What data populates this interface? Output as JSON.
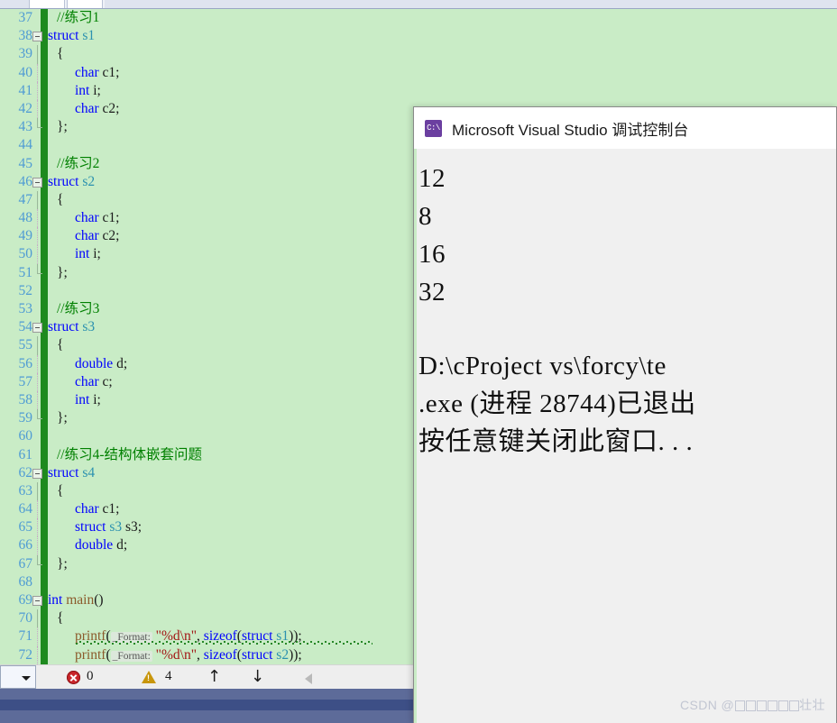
{
  "window": {
    "editor_background": "#c9ecc6",
    "change_bar_color": "#1e8a1e",
    "line_number_color": "#4f9bd4"
  },
  "editor": {
    "first_line_number": 37,
    "lines": [
      {
        "n": 37,
        "indent": 1,
        "fold": false,
        "guide": "none",
        "tokens": [
          {
            "t": "//练习1",
            "c": "cmt"
          }
        ]
      },
      {
        "n": 38,
        "indent": 0,
        "fold": true,
        "guide": "none",
        "tokens": [
          {
            "t": "struct",
            "c": "kw"
          },
          {
            "t": " ",
            "c": "plain"
          },
          {
            "t": "s1",
            "c": "typ"
          }
        ]
      },
      {
        "n": 39,
        "indent": 1,
        "fold": false,
        "guide": "solid",
        "tokens": [
          {
            "t": "{",
            "c": "plain"
          }
        ]
      },
      {
        "n": 40,
        "indent": 3,
        "fold": false,
        "guide": "dotted",
        "tokens": [
          {
            "t": "char",
            "c": "kw"
          },
          {
            "t": " c1;",
            "c": "plain"
          }
        ]
      },
      {
        "n": 41,
        "indent": 3,
        "fold": false,
        "guide": "dotted",
        "tokens": [
          {
            "t": "int",
            "c": "kw"
          },
          {
            "t": " i;",
            "c": "plain"
          }
        ]
      },
      {
        "n": 42,
        "indent": 3,
        "fold": false,
        "guide": "dotted",
        "tokens": [
          {
            "t": "char",
            "c": "kw"
          },
          {
            "t": " c2;",
            "c": "plain"
          }
        ]
      },
      {
        "n": 43,
        "indent": 1,
        "fold": false,
        "guide": "endcap",
        "tokens": [
          {
            "t": "};",
            "c": "plain"
          }
        ]
      },
      {
        "n": 44,
        "indent": 0,
        "fold": false,
        "guide": "none",
        "tokens": []
      },
      {
        "n": 45,
        "indent": 1,
        "fold": false,
        "guide": "none",
        "tokens": [
          {
            "t": "//练习2",
            "c": "cmt"
          }
        ]
      },
      {
        "n": 46,
        "indent": 0,
        "fold": true,
        "guide": "none",
        "tokens": [
          {
            "t": "struct",
            "c": "kw"
          },
          {
            "t": " ",
            "c": "plain"
          },
          {
            "t": "s2",
            "c": "typ"
          }
        ]
      },
      {
        "n": 47,
        "indent": 1,
        "fold": false,
        "guide": "solid",
        "tokens": [
          {
            "t": "{",
            "c": "plain"
          }
        ]
      },
      {
        "n": 48,
        "indent": 3,
        "fold": false,
        "guide": "dotted",
        "tokens": [
          {
            "t": "char",
            "c": "kw"
          },
          {
            "t": " c1;",
            "c": "plain"
          }
        ]
      },
      {
        "n": 49,
        "indent": 3,
        "fold": false,
        "guide": "dotted",
        "tokens": [
          {
            "t": "char",
            "c": "kw"
          },
          {
            "t": " c2;",
            "c": "plain"
          }
        ]
      },
      {
        "n": 50,
        "indent": 3,
        "fold": false,
        "guide": "dotted",
        "tokens": [
          {
            "t": "int",
            "c": "kw"
          },
          {
            "t": " i;",
            "c": "plain"
          }
        ]
      },
      {
        "n": 51,
        "indent": 1,
        "fold": false,
        "guide": "endcap",
        "tokens": [
          {
            "t": "};",
            "c": "plain"
          }
        ]
      },
      {
        "n": 52,
        "indent": 0,
        "fold": false,
        "guide": "none",
        "tokens": []
      },
      {
        "n": 53,
        "indent": 1,
        "fold": false,
        "guide": "none",
        "tokens": [
          {
            "t": "//练习3",
            "c": "cmt"
          }
        ]
      },
      {
        "n": 54,
        "indent": 0,
        "fold": true,
        "guide": "none",
        "tokens": [
          {
            "t": "struct",
            "c": "kw"
          },
          {
            "t": " ",
            "c": "plain"
          },
          {
            "t": "s3",
            "c": "typ"
          }
        ]
      },
      {
        "n": 55,
        "indent": 1,
        "fold": false,
        "guide": "solid",
        "tokens": [
          {
            "t": "{",
            "c": "plain"
          }
        ]
      },
      {
        "n": 56,
        "indent": 3,
        "fold": false,
        "guide": "dotted",
        "tokens": [
          {
            "t": "double",
            "c": "kw"
          },
          {
            "t": " d;",
            "c": "plain"
          }
        ]
      },
      {
        "n": 57,
        "indent": 3,
        "fold": false,
        "guide": "dotted",
        "tokens": [
          {
            "t": "char",
            "c": "kw"
          },
          {
            "t": " c;",
            "c": "plain"
          }
        ]
      },
      {
        "n": 58,
        "indent": 3,
        "fold": false,
        "guide": "dotted",
        "tokens": [
          {
            "t": "int",
            "c": "kw"
          },
          {
            "t": " i;",
            "c": "plain"
          }
        ]
      },
      {
        "n": 59,
        "indent": 1,
        "fold": false,
        "guide": "endcap",
        "tokens": [
          {
            "t": "};",
            "c": "plain"
          }
        ]
      },
      {
        "n": 60,
        "indent": 0,
        "fold": false,
        "guide": "none",
        "tokens": []
      },
      {
        "n": 61,
        "indent": 1,
        "fold": false,
        "guide": "none",
        "tokens": [
          {
            "t": "//练习4-结构体嵌套问题",
            "c": "cmt"
          }
        ]
      },
      {
        "n": 62,
        "indent": 0,
        "fold": true,
        "guide": "none",
        "tokens": [
          {
            "t": "struct",
            "c": "kw"
          },
          {
            "t": " ",
            "c": "plain"
          },
          {
            "t": "s4",
            "c": "typ"
          }
        ]
      },
      {
        "n": 63,
        "indent": 1,
        "fold": false,
        "guide": "solid",
        "tokens": [
          {
            "t": "{",
            "c": "plain"
          }
        ]
      },
      {
        "n": 64,
        "indent": 3,
        "fold": false,
        "guide": "dotted",
        "tokens": [
          {
            "t": "char",
            "c": "kw"
          },
          {
            "t": " c1;",
            "c": "plain"
          }
        ]
      },
      {
        "n": 65,
        "indent": 3,
        "fold": false,
        "guide": "dotted",
        "tokens": [
          {
            "t": "struct",
            "c": "kw"
          },
          {
            "t": " ",
            "c": "plain"
          },
          {
            "t": "s3",
            "c": "typ"
          },
          {
            "t": " s3;",
            "c": "plain"
          }
        ]
      },
      {
        "n": 66,
        "indent": 3,
        "fold": false,
        "guide": "dotted",
        "tokens": [
          {
            "t": "double",
            "c": "kw"
          },
          {
            "t": " d;",
            "c": "plain"
          }
        ]
      },
      {
        "n": 67,
        "indent": 1,
        "fold": false,
        "guide": "endcap",
        "tokens": [
          {
            "t": "};",
            "c": "plain"
          }
        ]
      },
      {
        "n": 68,
        "indent": 0,
        "fold": false,
        "guide": "none",
        "tokens": []
      },
      {
        "n": 69,
        "indent": 0,
        "fold": true,
        "guide": "none",
        "tokens": [
          {
            "t": "int",
            "c": "kw"
          },
          {
            "t": " ",
            "c": "plain"
          },
          {
            "t": "main",
            "c": "fn"
          },
          {
            "t": "()",
            "c": "plain"
          }
        ]
      },
      {
        "n": 70,
        "indent": 1,
        "fold": false,
        "guide": "solid",
        "tokens": [
          {
            "t": "{",
            "c": "plain"
          }
        ]
      },
      {
        "n": 71,
        "indent": 3,
        "fold": false,
        "guide": "dotted",
        "squiggle": true,
        "tokens": [
          {
            "t": "printf",
            "c": "fn"
          },
          {
            "t": "(",
            "c": "plain"
          },
          {
            "t": "_Format:",
            "c": "hint"
          },
          {
            "t": " ",
            "c": "plain"
          },
          {
            "t": "\"%d\\n\"",
            "c": "str"
          },
          {
            "t": ", ",
            "c": "plain"
          },
          {
            "t": "sizeof",
            "c": "kw"
          },
          {
            "t": "(",
            "c": "plain"
          },
          {
            "t": "struct",
            "c": "kw"
          },
          {
            "t": " ",
            "c": "plain"
          },
          {
            "t": "s1",
            "c": "typ"
          },
          {
            "t": "));",
            "c": "plain"
          }
        ]
      },
      {
        "n": 72,
        "indent": 3,
        "fold": false,
        "guide": "dotted",
        "clipped": true,
        "tokens": [
          {
            "t": "printf",
            "c": "fn"
          },
          {
            "t": "(",
            "c": "plain"
          },
          {
            "t": "_Format:",
            "c": "hint"
          },
          {
            "t": " ",
            "c": "plain"
          },
          {
            "t": "\"%d\\n\"",
            "c": "str"
          },
          {
            "t": ", ",
            "c": "plain"
          },
          {
            "t": "sizeof",
            "c": "kw"
          },
          {
            "t": "(",
            "c": "plain"
          },
          {
            "t": "struct",
            "c": "kw"
          },
          {
            "t": " ",
            "c": "plain"
          },
          {
            "t": "s2",
            "c": "typ"
          },
          {
            "t": "));",
            "c": "plain"
          }
        ]
      }
    ]
  },
  "statusbar": {
    "error_icon": "error-circle-icon",
    "error_count": "0",
    "warning_icon": "warning-triangle-icon",
    "warning_count": "4",
    "prev_arrow": "↑",
    "next_arrow": "↓",
    "back_icon": "left-triangle-icon"
  },
  "console": {
    "icon_label": "C:\\",
    "icon_name": "console-app-icon",
    "title": "Microsoft Visual Studio 调试控制台",
    "output_lines": [
      "12",
      "8",
      "16",
      "32",
      "",
      "D:\\cProject vs\\forcy\\te",
      ".exe (进程 28744)已退出",
      "按任意键关闭此窗口. . ."
    ]
  },
  "watermark": {
    "prefix": "CSDN @",
    "tofu_count": 6,
    "suffix": "壮壮"
  }
}
